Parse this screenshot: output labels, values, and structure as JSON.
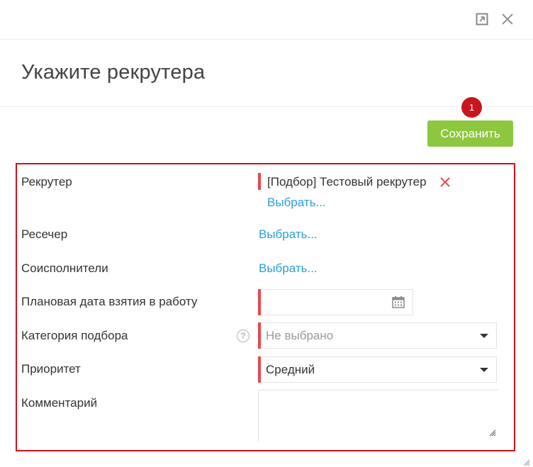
{
  "dialog": {
    "title": "Укажите рекрутера",
    "badge": "1",
    "save_label": "Сохранить"
  },
  "colors": {
    "accent_green": "#8dc63f",
    "link_blue": "#2a9fd6",
    "required_red": "#e8474e",
    "highlight_frame": "#d0111b",
    "badge_red": "#c8161d"
  },
  "form": {
    "recruiter": {
      "label": "Рекрутер",
      "selected": "[Подбор] Тестовый рекрутер",
      "choose": "Выбрать..."
    },
    "researcher": {
      "label": "Ресечер",
      "choose": "Выбрать..."
    },
    "coexecutors": {
      "label": "Соисполнители",
      "choose": "Выбрать..."
    },
    "planned_date": {
      "label": "Плановая дата взятия в работу",
      "value": ""
    },
    "category": {
      "label": "Категория подбора",
      "help": "?",
      "value": "Не выбрано"
    },
    "priority": {
      "label": "Приоритет",
      "value": "Средний"
    },
    "comment": {
      "label": "Комментарий",
      "value": ""
    }
  }
}
